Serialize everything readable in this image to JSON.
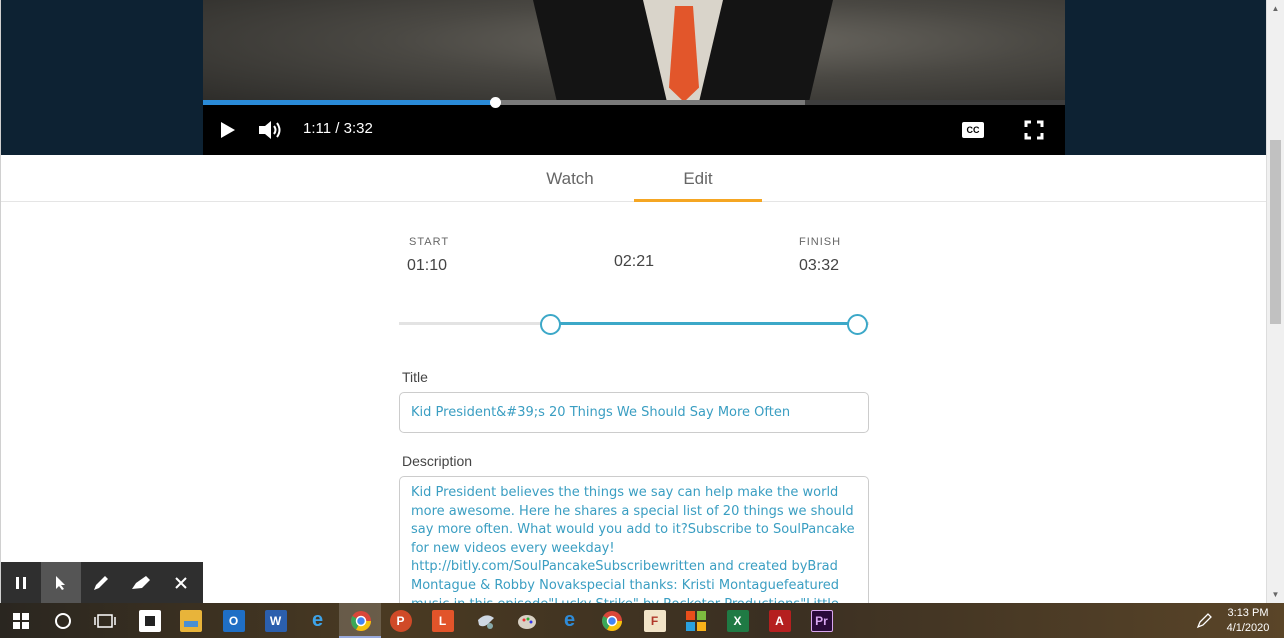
{
  "video": {
    "current_time": "1:11",
    "separator": " / ",
    "duration": "3:32",
    "progress_fraction": 0.339,
    "buffered_fraction": 0.698,
    "icons": [
      "play-icon",
      "volume-icon",
      "closed-captions-icon",
      "fullscreen-icon"
    ],
    "cc_label": "CC",
    "accent_color": "#2a8bd8"
  },
  "tabs": [
    {
      "label": "Watch",
      "active": false
    },
    {
      "label": "Edit",
      "active": true
    }
  ],
  "tab_accent_color": "#f5a623",
  "clip": {
    "start_label": "START",
    "start_value": "01:10",
    "length_value": "02:21",
    "finish_label": "FINISH",
    "finish_value": "03:32",
    "range_start_fraction": 0.33,
    "range_end_fraction": 1.0,
    "range_color": "#3ca8c8"
  },
  "form": {
    "title_label": "Title",
    "title_value": "Kid President&#39;s 20 Things We Should Say More Often",
    "description_label": "Description",
    "description_value": "Kid President believes the things we say can help make the world more awesome. Here he shares a special list of 20 things we should say more often. What would you add to it?Subscribe to SoulPancake for new videos every weekday! http://bitly.com/SoulPancakeSubscribewritten and created byBrad Montague & Robby Novakspecial thanks: Kristi Montaguefeatured music in this episode\"Lucky Strike\" by Rocketer Productions\"Little"
  },
  "annotation_toolbar": {
    "tools": [
      "pause-icon",
      "pointer-icon",
      "pen-icon",
      "highlighter-icon",
      "close-icon"
    ]
  },
  "taskbar": {
    "apps": [
      "windows-start-icon",
      "cortana-icon",
      "task-view-icon",
      "sticky-notes-icon",
      "file-explorer-icon",
      "outlook-icon",
      "word-icon",
      "internet-explorer-icon",
      "chrome-icon",
      "powerpoint-icon",
      "l-app-icon",
      "paint-3d-icon",
      "photos-icon",
      "edge-icon",
      "chrome-alt-icon",
      "f-app-icon",
      "office-icon",
      "excel-icon",
      "acrobat-icon",
      "premiere-icon"
    ],
    "time": "3:13 PM",
    "date": "4/1/2020"
  }
}
